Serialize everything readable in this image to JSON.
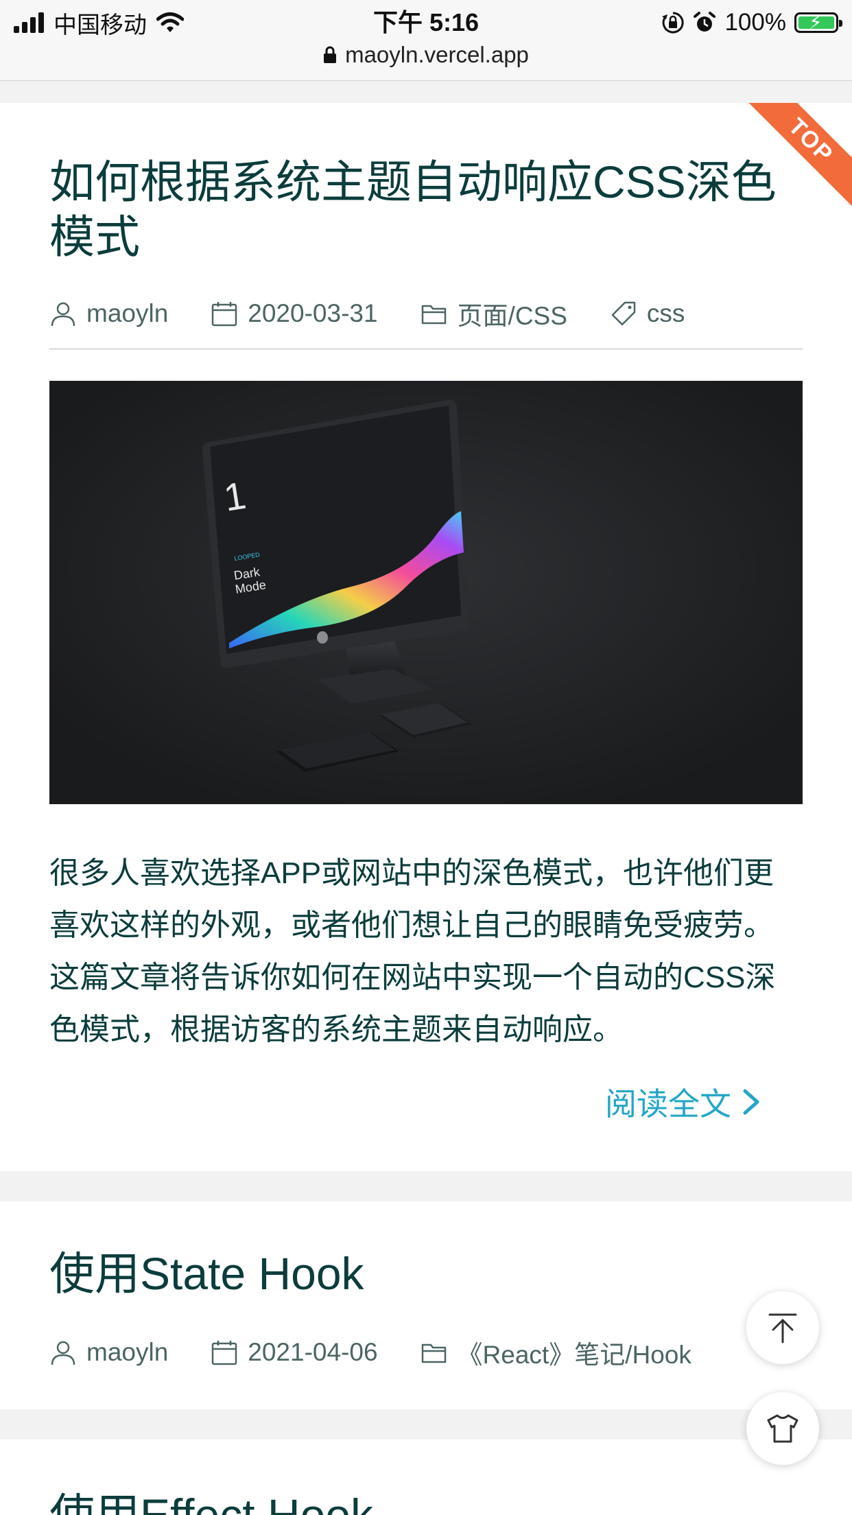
{
  "status_bar": {
    "carrier": "中国移动",
    "time": "下午 5:16",
    "battery_percent": "100%",
    "battery_level": 1.0,
    "url": "maoyln.vercel.app"
  },
  "posts": [
    {
      "badge": "TOP",
      "title": "如何根据系统主题自动响应CSS深色模式",
      "author": "maoyln",
      "date": "2020-03-31",
      "category": "页面/CSS",
      "tag": "css",
      "image_text": {
        "number": "1",
        "brand": "LOOPED",
        "heading_line1": "Dark",
        "heading_line2": "Mode"
      },
      "excerpt": "很多人喜欢选择APP或网站中的深色模式，也许他们更喜欢这样的外观，或者他们想让自己的眼睛免受疲劳。这篇文章将告诉你如何在网站中实现一个自动的CSS深色模式，根据访客的系统主题来自动响应。",
      "read_more": "阅读全文"
    },
    {
      "title": "使用State Hook",
      "author": "maoyln",
      "date": "2021-04-06",
      "category": "《React》笔记/Hook"
    },
    {
      "title": "使用Effect Hook"
    }
  ],
  "colors": {
    "title": "#0c3c3c",
    "meta": "#4c6464",
    "link": "#23a6c7",
    "ribbon": "#f26b3a",
    "page_bg": "#f2f2f2"
  },
  "icons": [
    "signal-icon",
    "wifi-icon",
    "orientation-lock-icon",
    "alarm-icon",
    "battery-icon",
    "lock-icon",
    "user-icon",
    "calendar-icon",
    "folder-icon",
    "tag-icon",
    "chevron-right-icon",
    "arrow-up-icon",
    "tshirt-icon"
  ]
}
